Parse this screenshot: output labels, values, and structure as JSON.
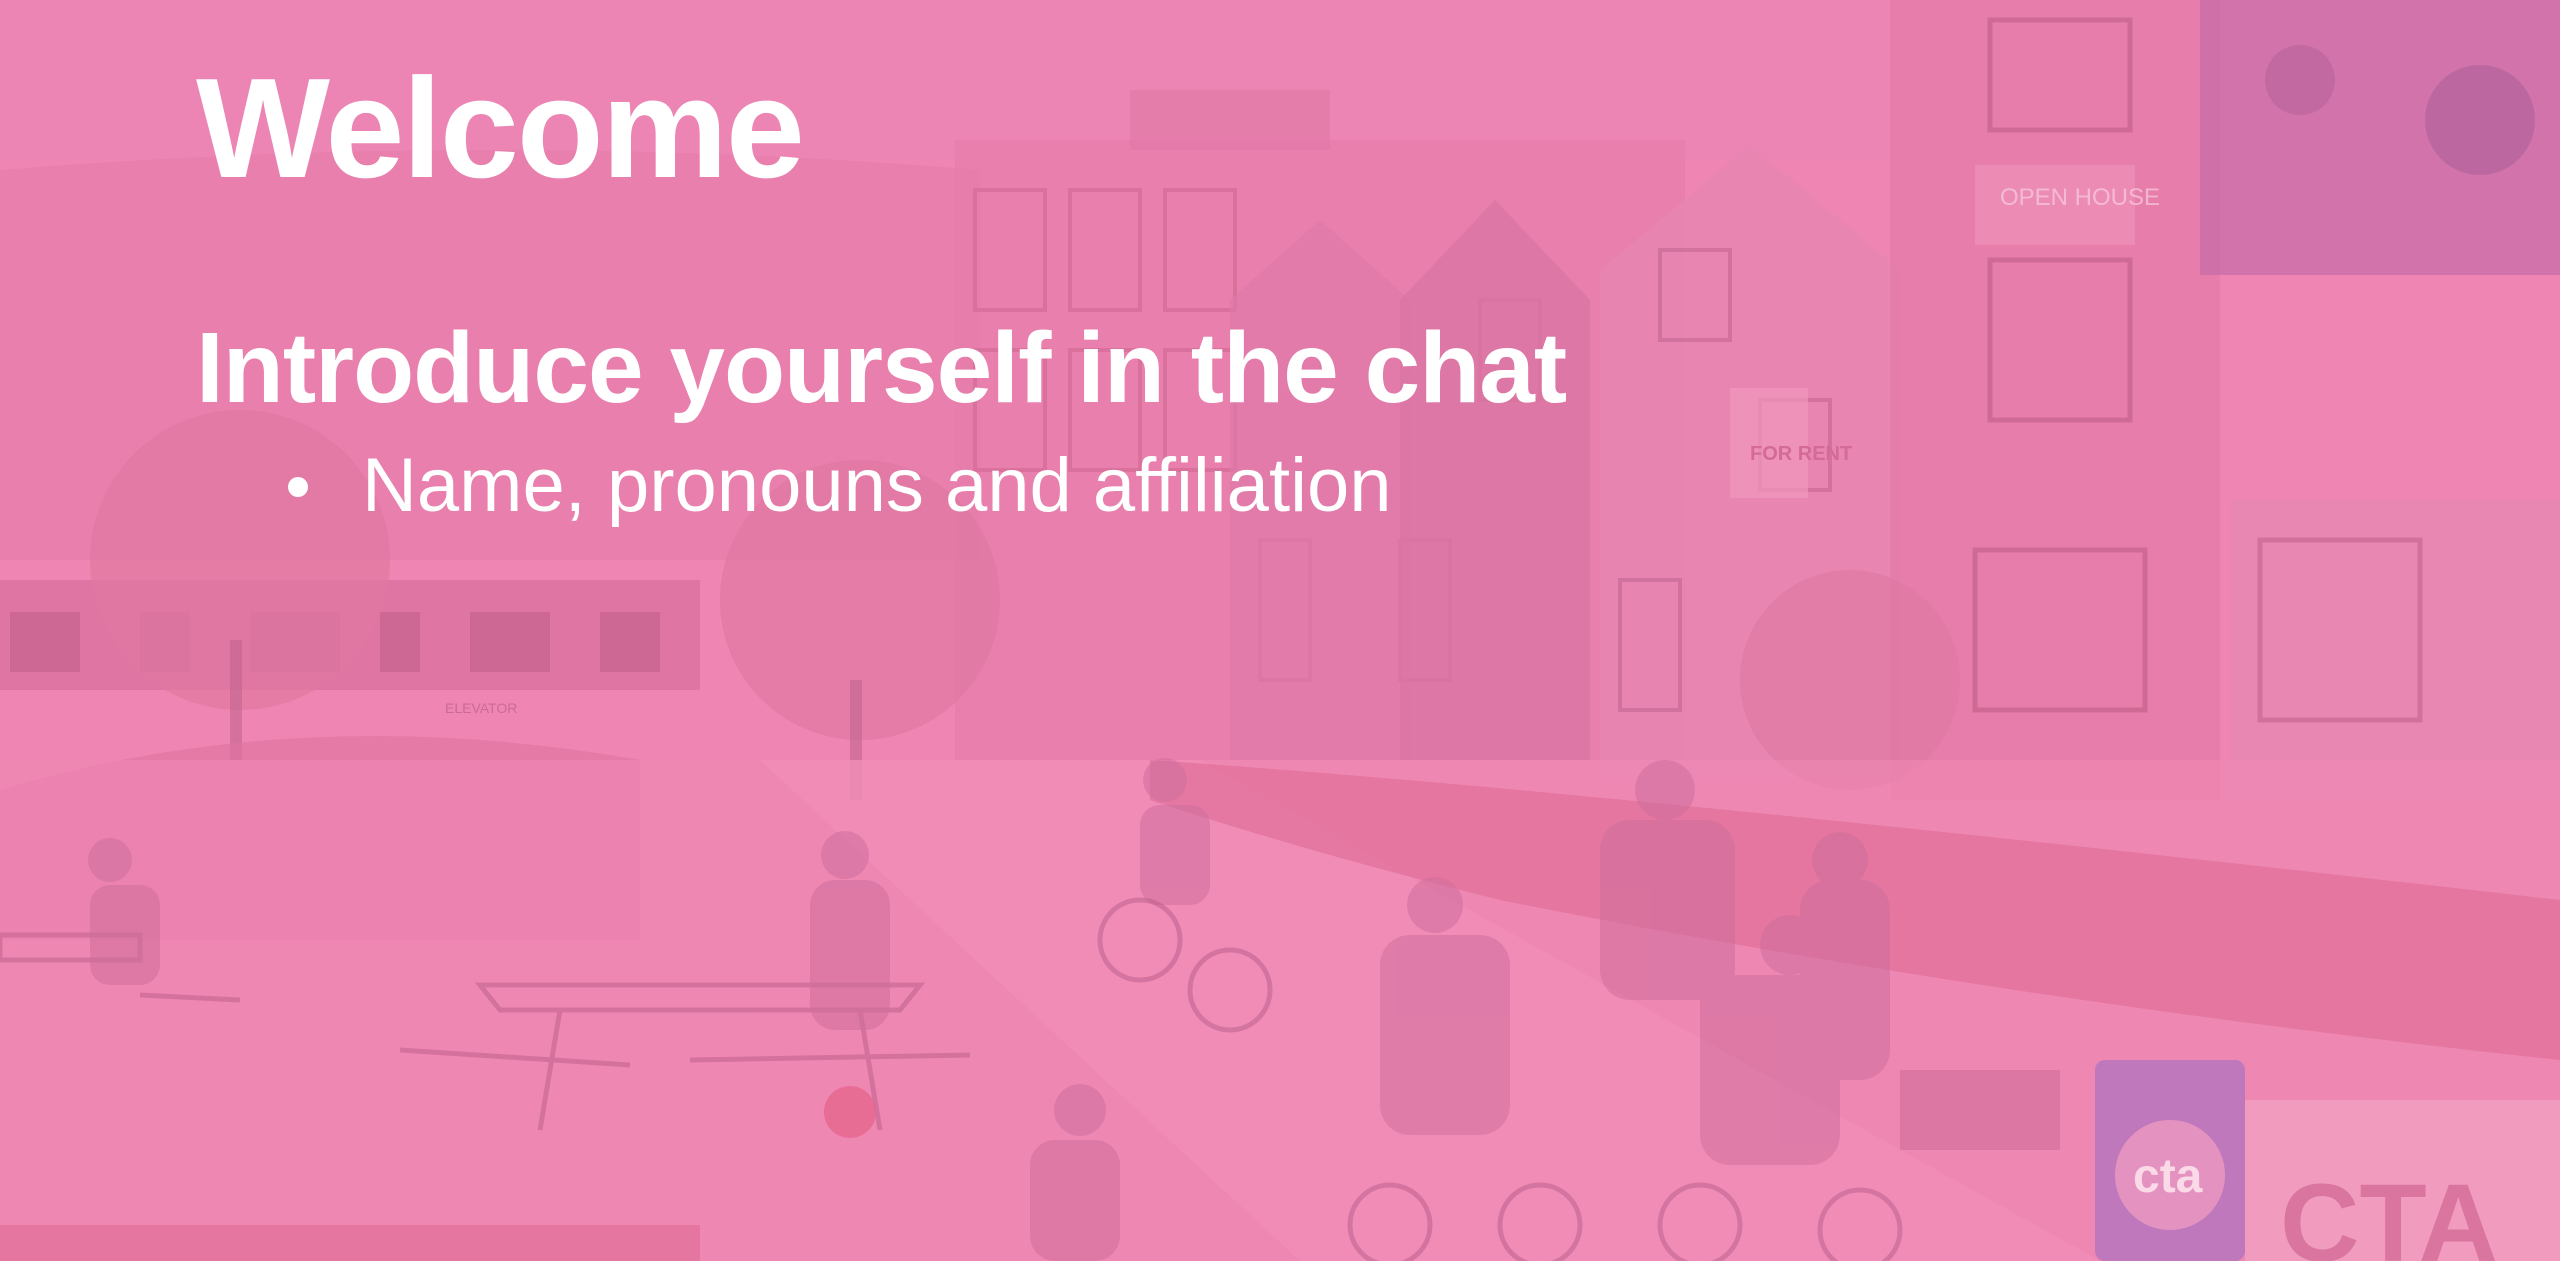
{
  "slide": {
    "title": "Welcome",
    "heading": "Introduce yourself in the chat",
    "bullets": [
      "Name, pronouns and affiliation"
    ],
    "background_color": "#ee8ab4",
    "text_color": "#ffffff",
    "illustration_signs": {
      "open_house": "OPEN HOUSE",
      "for_rent": "FOR RENT",
      "elevator": "ELEVATOR",
      "transit_logo": "cta",
      "transit_text": "CTA"
    }
  }
}
